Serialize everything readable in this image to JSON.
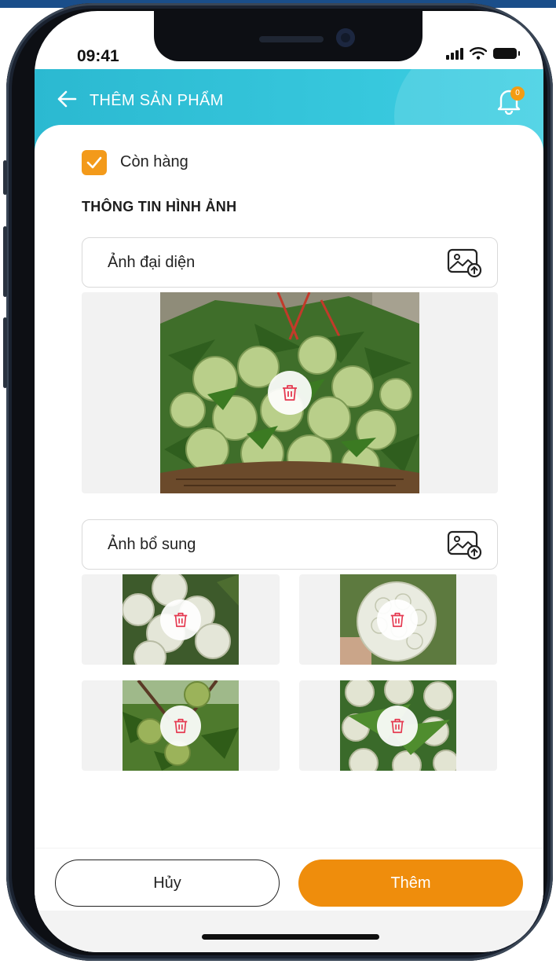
{
  "status_bar": {
    "time": "09:41"
  },
  "header": {
    "title": "THÊM SẢN PHẨM",
    "notification_count": "0"
  },
  "form": {
    "in_stock_label": "Còn hàng",
    "in_stock_checked": true,
    "section_title": "THÔNG TIN HÌNH ẢNH",
    "main_image_label": "Ảnh đại diện",
    "extra_images_label": "Ảnh bổ sung"
  },
  "actions": {
    "cancel_label": "Hủy",
    "submit_label": "Thêm"
  },
  "colors": {
    "header": "#2bb9d1",
    "accent": "#ef8d0c",
    "checkbox": "#f39a1a",
    "delete_icon": "#e53950"
  },
  "icons": [
    "back-arrow-icon",
    "bell-icon",
    "checkmark-icon",
    "image-upload-icon",
    "trash-icon"
  ]
}
